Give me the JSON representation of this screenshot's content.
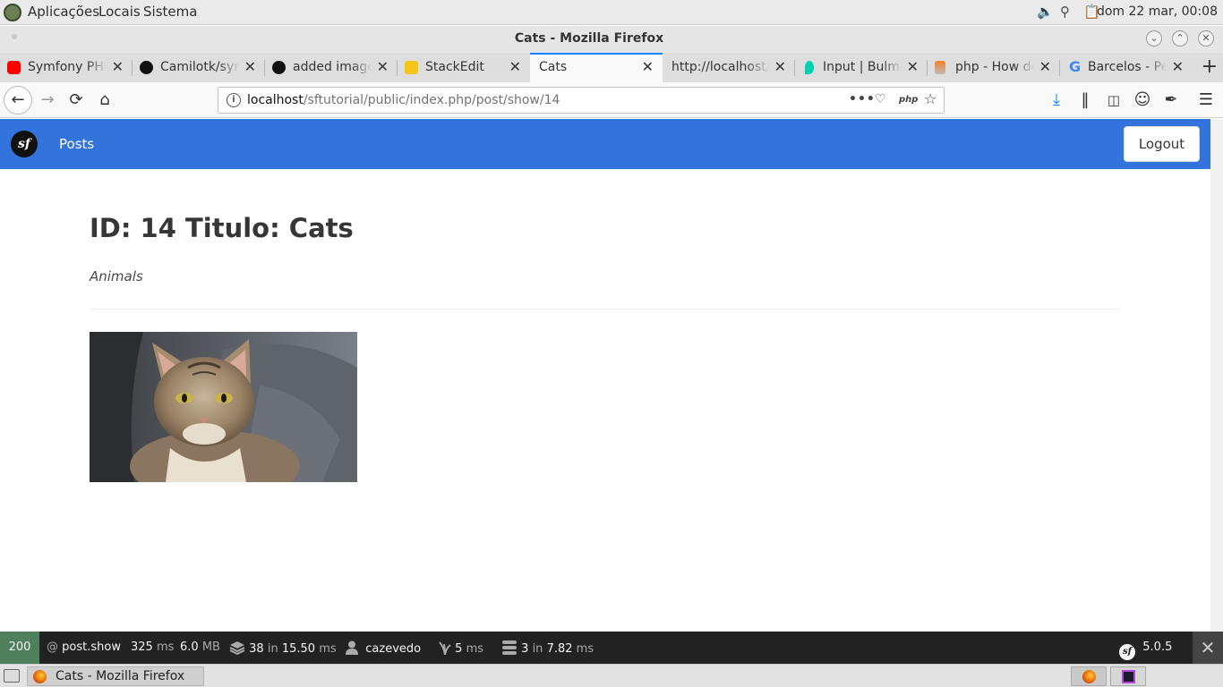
{
  "panel": {
    "menus": [
      "Aplicações",
      "Locais",
      "Sistema"
    ],
    "clock": "dom 22 mar, 00:08"
  },
  "window": {
    "title": "Cats - Mozilla Firefox"
  },
  "tabs": [
    {
      "label": "Symfony PHP",
      "favicon": "youtube-icon",
      "color": "#ff0000"
    },
    {
      "label": "Camilotk/sym",
      "favicon": "github-icon",
      "color": "#111111"
    },
    {
      "label": "added images",
      "favicon": "github-icon",
      "color": "#111111"
    },
    {
      "label": "StackEdit",
      "favicon": "stackedit-icon",
      "color": "#f5c518"
    },
    {
      "label": "Cats",
      "active": true
    },
    {
      "label": "http://localhost/s",
      "favicon": "none"
    },
    {
      "label": "Input | Bulma",
      "favicon": "bulma-icon",
      "color": "#00d1b2"
    },
    {
      "label": "php - How do",
      "favicon": "stackoverflow-icon",
      "color": "#f48024"
    },
    {
      "label": "Barcelos - Pe",
      "favicon": "google-icon",
      "color": "#4285f4"
    }
  ],
  "urlbar": {
    "host": "localhost",
    "path": "/sftutorial/public/index.php/post/show/14"
  },
  "site": {
    "logo_text": "sf",
    "nav_posts": "Posts",
    "logout": "Logout",
    "accent": "#3273dc"
  },
  "post": {
    "title": "ID: 14 Titulo: Cats",
    "category": "Animals"
  },
  "debug_toolbar": {
    "status": "200",
    "route": "post.show",
    "time": "325",
    "time_unit": "ms",
    "memory": "6.0",
    "memory_unit": "MB",
    "cache_count": "38",
    "cache_in": "in",
    "cache_time": "15.50",
    "cache_unit": "ms",
    "user": "cazevedo",
    "twig_time": "5",
    "twig_unit": "ms",
    "db_queries": "3",
    "db_in": "in",
    "db_time": "7.82",
    "db_unit": "ms",
    "symfony_version": "5.0.5"
  },
  "taskbar": {
    "window_title": "Cats - Mozilla Firefox"
  }
}
